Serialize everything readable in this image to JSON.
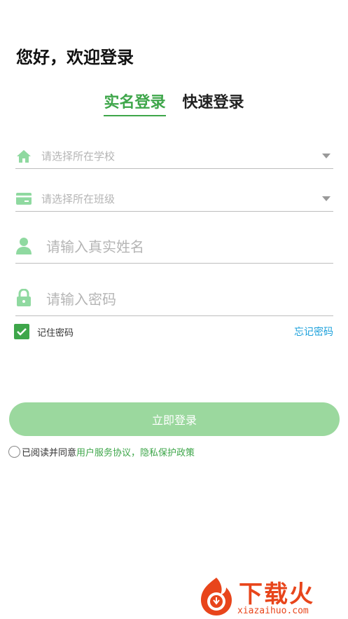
{
  "greeting": "您好，欢迎登录",
  "tabs": [
    {
      "label": "实名登录",
      "active": true
    },
    {
      "label": "快速登录",
      "active": false
    }
  ],
  "fields": {
    "school": {
      "placeholder": "请选择所在学校",
      "icon": "home-icon"
    },
    "class": {
      "placeholder": "请选择所在班级",
      "icon": "card-icon"
    },
    "name": {
      "placeholder": "请输入真实姓名",
      "icon": "user-icon"
    },
    "password": {
      "placeholder": "请输入密码",
      "icon": "lock-icon"
    }
  },
  "remember": {
    "label": "记住密码",
    "checked": true
  },
  "forgot": "忘记密码",
  "login_button": "立即登录",
  "agreement": {
    "prefix": "已阅读并同意",
    "link": "用户服务协议，隐私保护政策"
  },
  "watermark": {
    "brand": "下载火",
    "url": "xiazaihuo.com"
  },
  "colors": {
    "primary": "#3ea64a",
    "button": "#9bd89e",
    "link": "#1ba0db",
    "icon": "#8fd9a0",
    "watermark": "#e8451b"
  }
}
